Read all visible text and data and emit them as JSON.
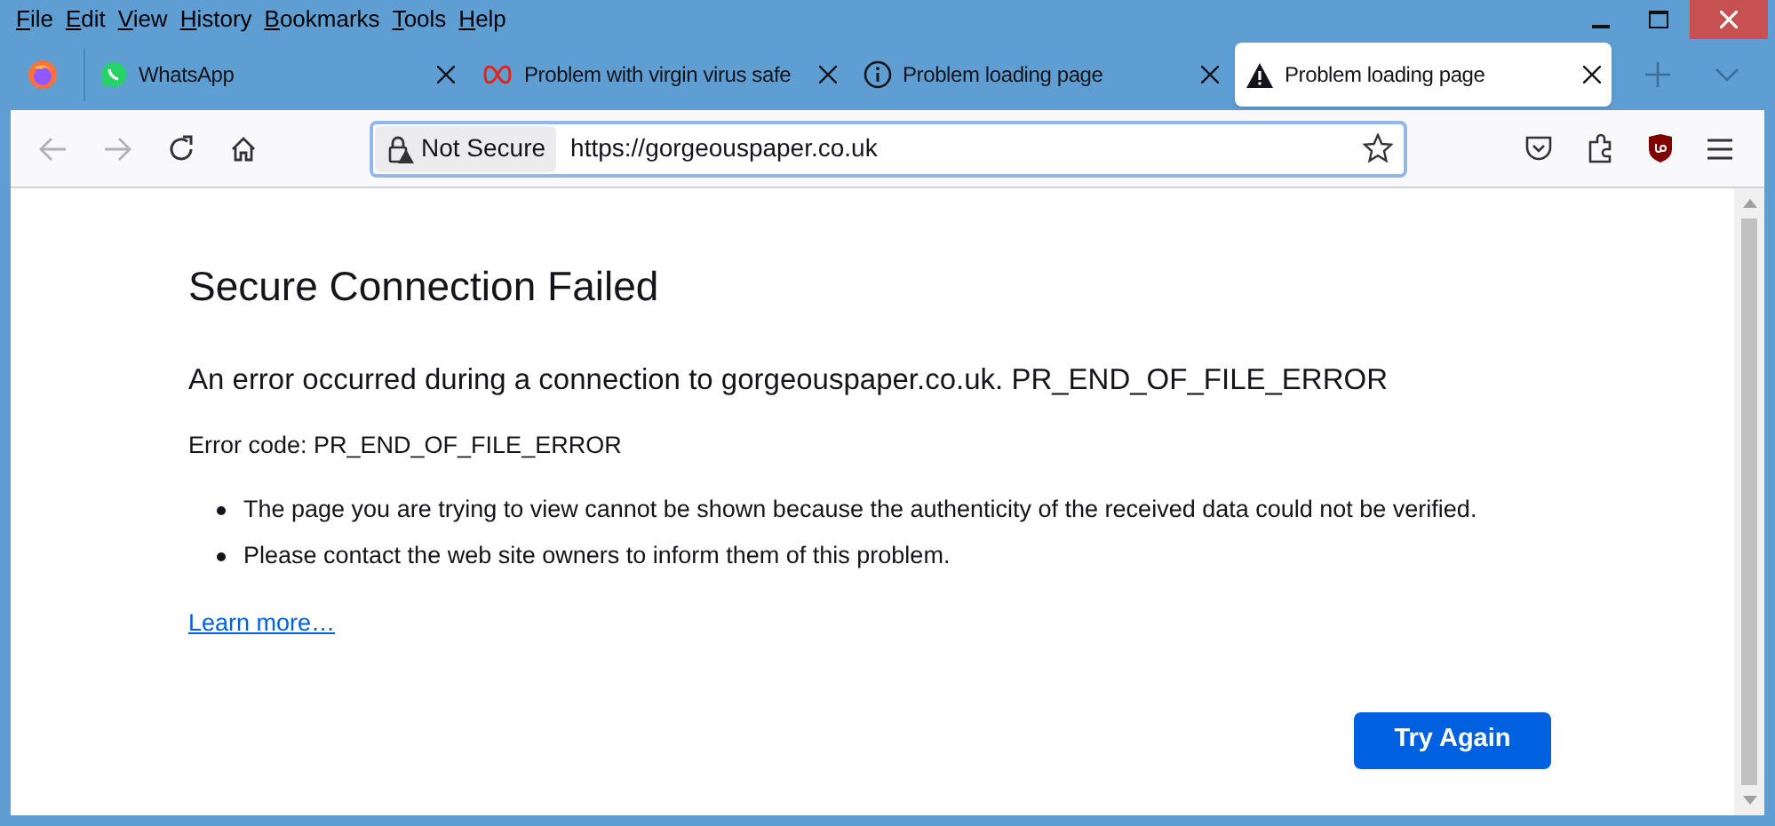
{
  "menu": [
    "File",
    "Edit",
    "View",
    "History",
    "Bookmarks",
    "Tools",
    "Help"
  ],
  "tabs": [
    {
      "kind": "whatsapp",
      "title": "WhatsApp",
      "selected": false
    },
    {
      "kind": "loop",
      "title": "Problem with virgin virus safe",
      "selected": false
    },
    {
      "kind": "info",
      "title": "Problem loading page",
      "selected": false
    },
    {
      "kind": "warning",
      "title": "Problem loading page",
      "selected": true
    }
  ],
  "address_bar": {
    "security": "Not Secure",
    "url": "https://gorgeouspaper.co.uk"
  },
  "page": {
    "title": "Secure Connection Failed",
    "message": "An error occurred during a connection to gorgeouspaper.co.uk. PR_END_OF_FILE_ERROR",
    "error_code": "Error code: PR_END_OF_FILE_ERROR",
    "bullets": [
      "The page you are trying to view cannot be shown because the authenticity of the received data could not be verified.",
      "Please contact the web site owners to inform them of this problem."
    ],
    "link": "Learn more…",
    "button": "Try Again"
  }
}
